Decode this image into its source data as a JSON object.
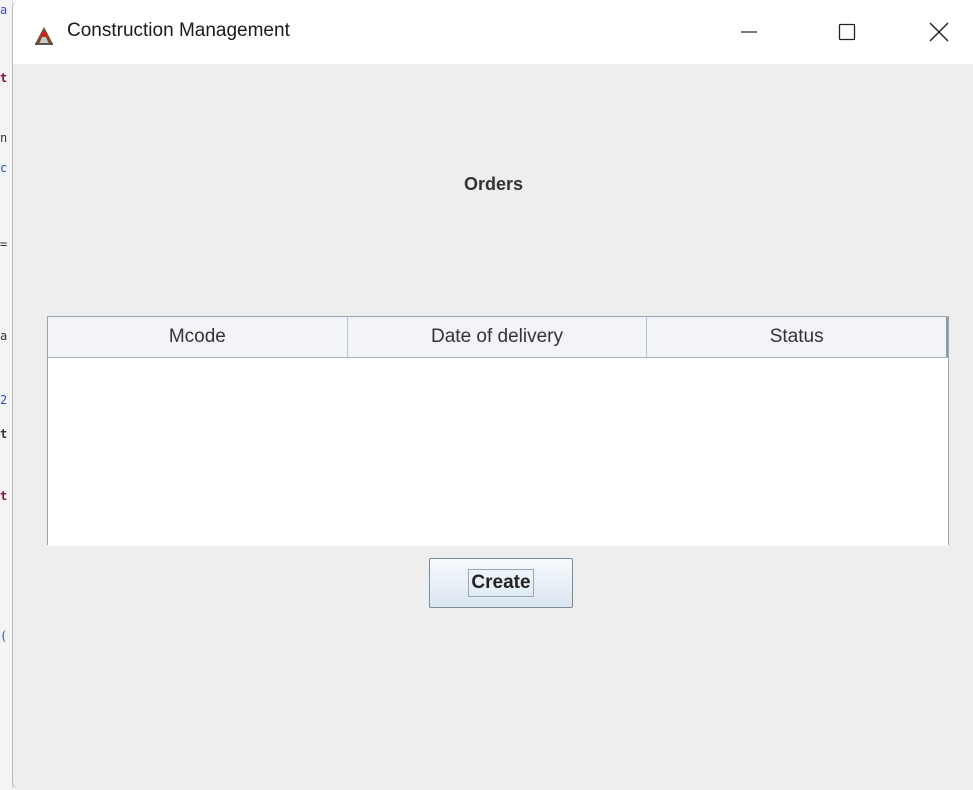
{
  "window": {
    "title": "Construction Management",
    "controls": {
      "minimize": "minimize-icon",
      "maximize": "maximize-icon",
      "close": "close-icon"
    }
  },
  "page": {
    "heading": "Orders"
  },
  "orders_table": {
    "columns": [
      "Mcode",
      "Date of delivery",
      "Status"
    ],
    "rows": []
  },
  "actions": {
    "create_label": "Create"
  },
  "colors": {
    "window_background": "#eeeeee",
    "titlebar_background": "#ffffff",
    "table_header_background": "#f2f4f7",
    "button_gradient_top": "#f6f9fc",
    "button_gradient_bottom": "#dbe6f1"
  }
}
